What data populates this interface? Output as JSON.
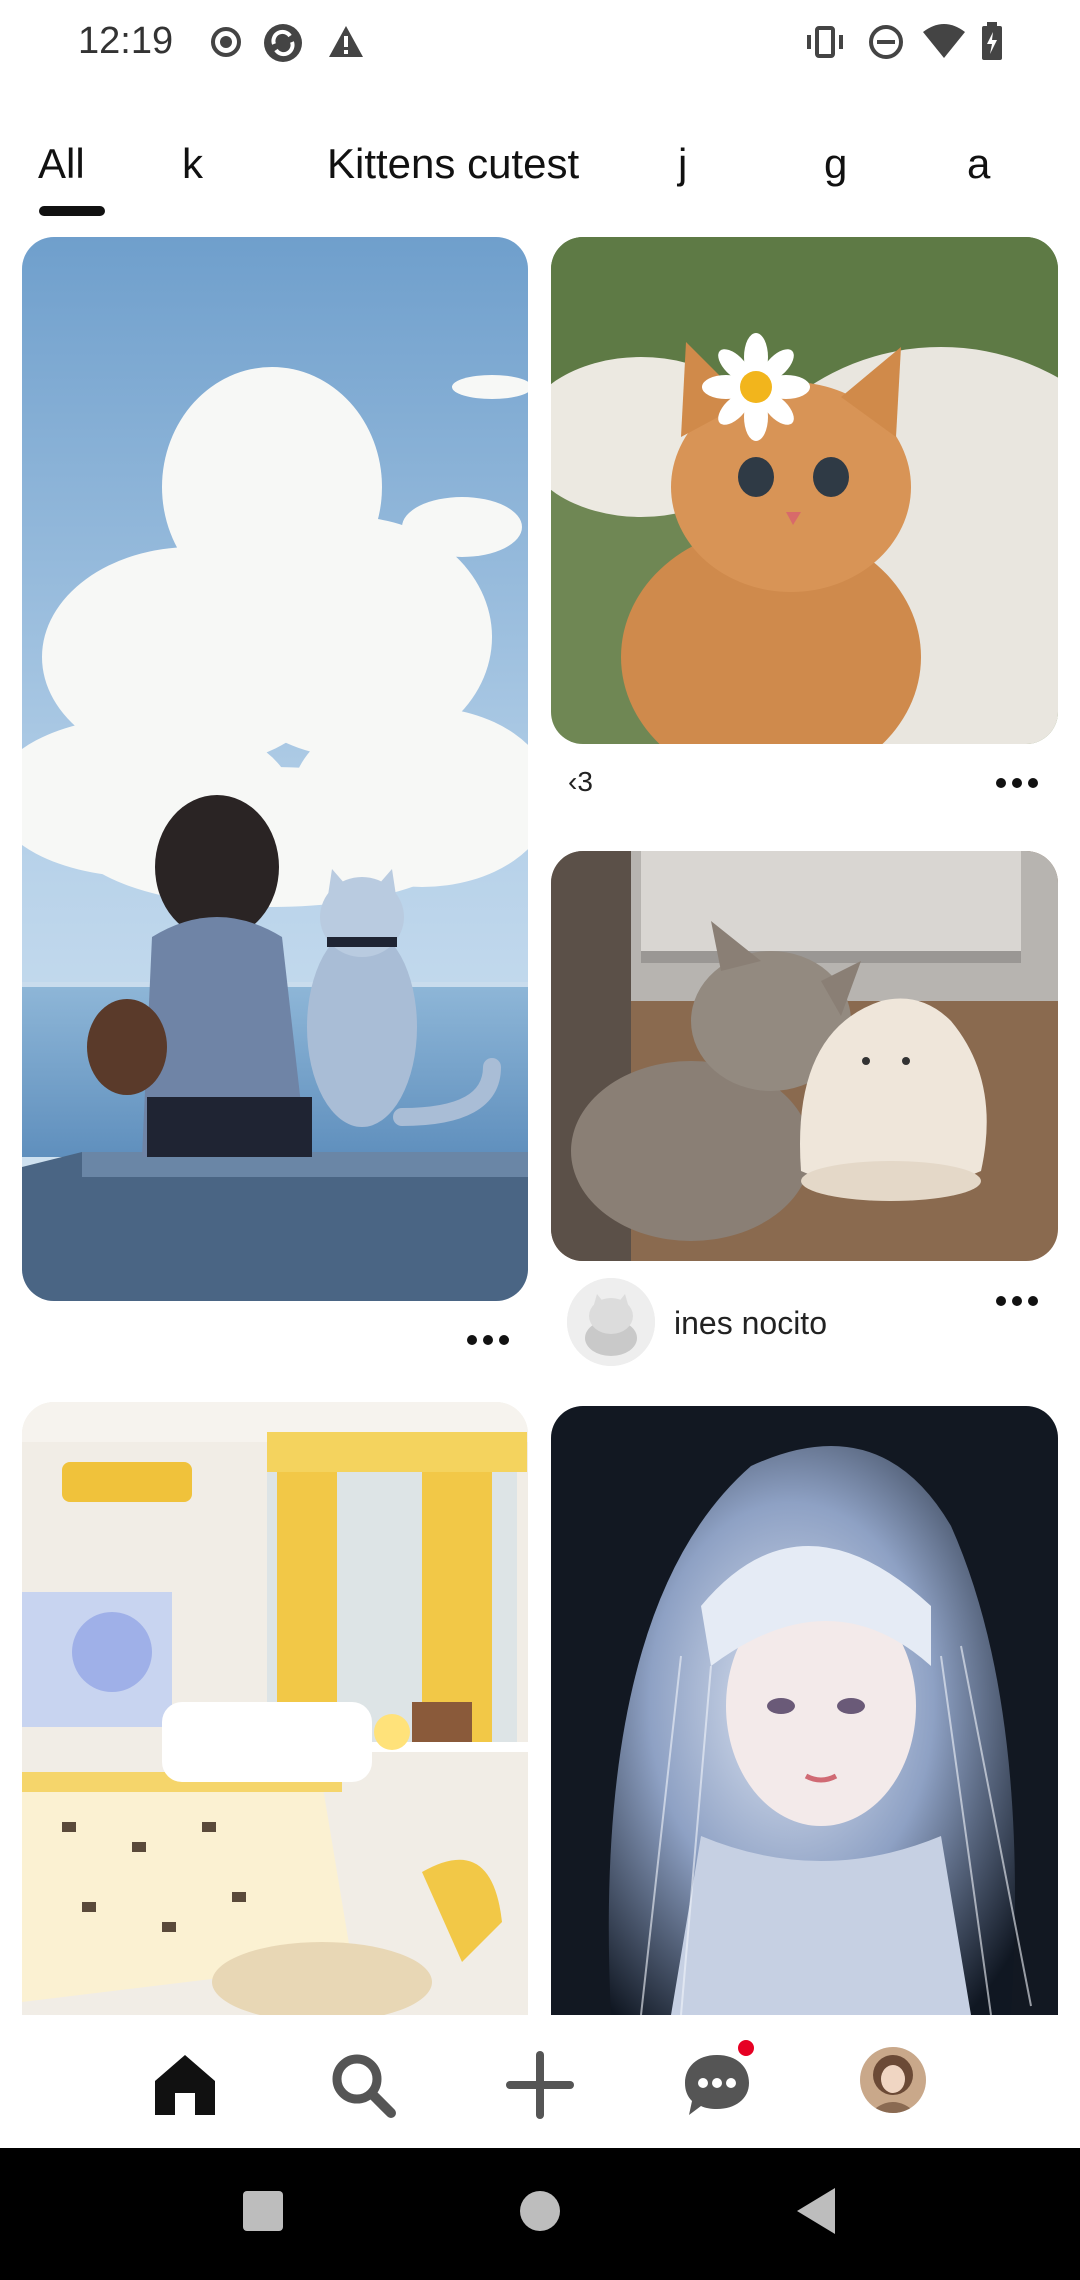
{
  "status_bar": {
    "time": "12:19",
    "left_icons": [
      "record-icon",
      "sync-icon",
      "warning-icon"
    ],
    "right_icons": [
      "vibrate-icon",
      "do-not-disturb-icon",
      "wifi-icon",
      "battery-icon"
    ]
  },
  "tabs": {
    "items": [
      "All",
      "k",
      "Kittens cutest",
      "j",
      "g",
      "a"
    ],
    "selected": "All"
  },
  "feed": {
    "pins": [
      {
        "name": "anime-girl-cat-sea",
        "caption": "",
        "author": ""
      },
      {
        "name": "orange-kitten-daisy",
        "caption": "‹3",
        "author": ""
      },
      {
        "name": "tabby-kitten-lamp",
        "caption": "",
        "author": "ines nocito"
      },
      {
        "name": "yellow-bedroom",
        "caption": "",
        "author": ""
      },
      {
        "name": "white-hair-anime-girl",
        "caption": "",
        "author": ""
      }
    ]
  },
  "bottom_nav": {
    "items": [
      "home-icon",
      "search-icon",
      "create-icon",
      "messages-icon",
      "profile-avatar"
    ],
    "accent_color": "#e60023"
  }
}
